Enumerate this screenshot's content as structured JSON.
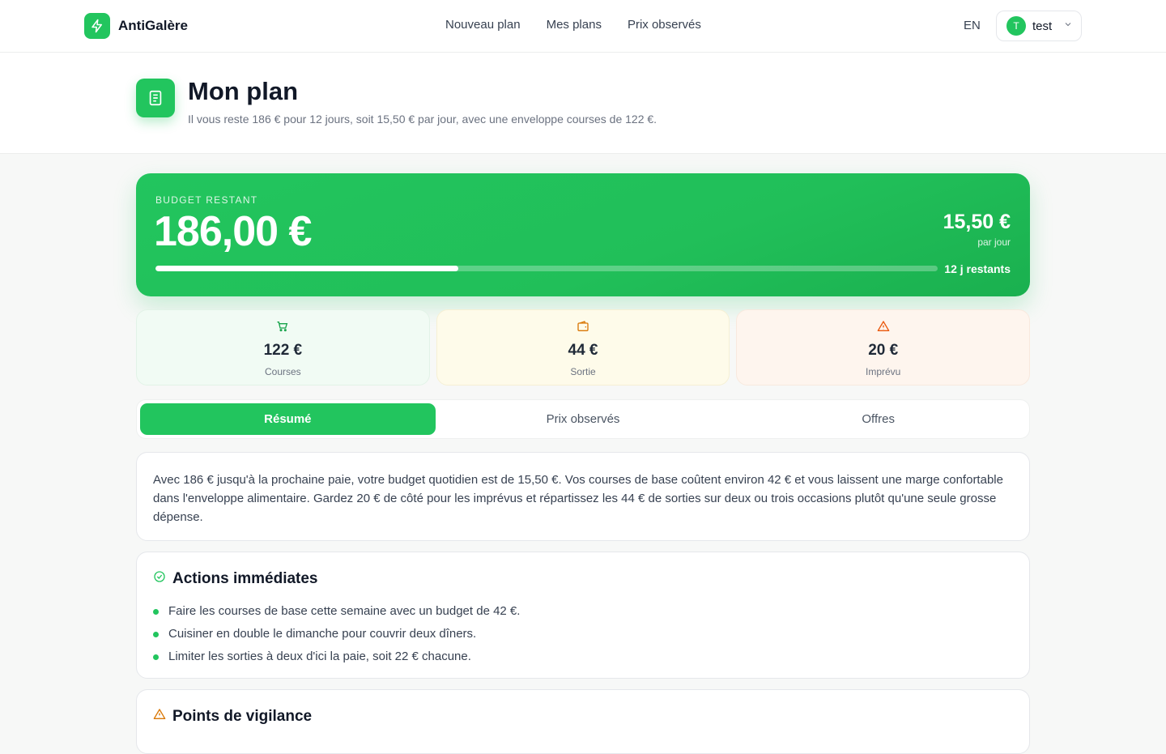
{
  "header": {
    "brand": "AntiGalère",
    "nav": [
      "Nouveau plan",
      "Mes plans",
      "Prix observés"
    ],
    "lang": "EN",
    "user": {
      "initial": "T",
      "name": "test"
    }
  },
  "page": {
    "title": "Mon plan",
    "subtitle": "Il vous reste 186 € pour 12 jours, soit 15,50 € par jour, avec une enveloppe courses de 122 €."
  },
  "budget": {
    "label": "BUDGET RESTANT",
    "amount": "186,00 €",
    "per_day": "15,50 €",
    "per_day_label": "par jour",
    "days_left": "12 j restants",
    "progress_fraction": 0.387
  },
  "stats": [
    {
      "icon": "cart-icon",
      "value": "122 €",
      "label": "Courses"
    },
    {
      "icon": "wallet-icon",
      "value": "44 €",
      "label": "Sortie"
    },
    {
      "icon": "warning-icon",
      "value": "20 €",
      "label": "Imprévu"
    }
  ],
  "tabs": [
    "Résumé",
    "Prix observés",
    "Offres"
  ],
  "summary": "Avec 186 € jusqu'à la prochaine paie, votre budget quotidien est de 15,50 €. Vos courses de base coûtent environ 42 € et vous laissent une marge confortable dans l'enveloppe alimentaire. Gardez 20 € de côté pour les imprévus et répartissez les 44 € de sorties sur deux ou trois occasions plutôt qu'une seule grosse dépense.",
  "actions": {
    "title": "Actions immédiates",
    "items": [
      "Faire les courses de base cette semaine avec un budget de 42 €.",
      "Cuisiner en double le dimanche pour couvrir deux dîners.",
      "Limiter les sorties à deux d'ici la paie, soit 22 € chacune."
    ]
  },
  "watch": {
    "title": "Points de vigilance"
  },
  "colors": {
    "accent": "#22c55e",
    "warning": "#d97706"
  }
}
